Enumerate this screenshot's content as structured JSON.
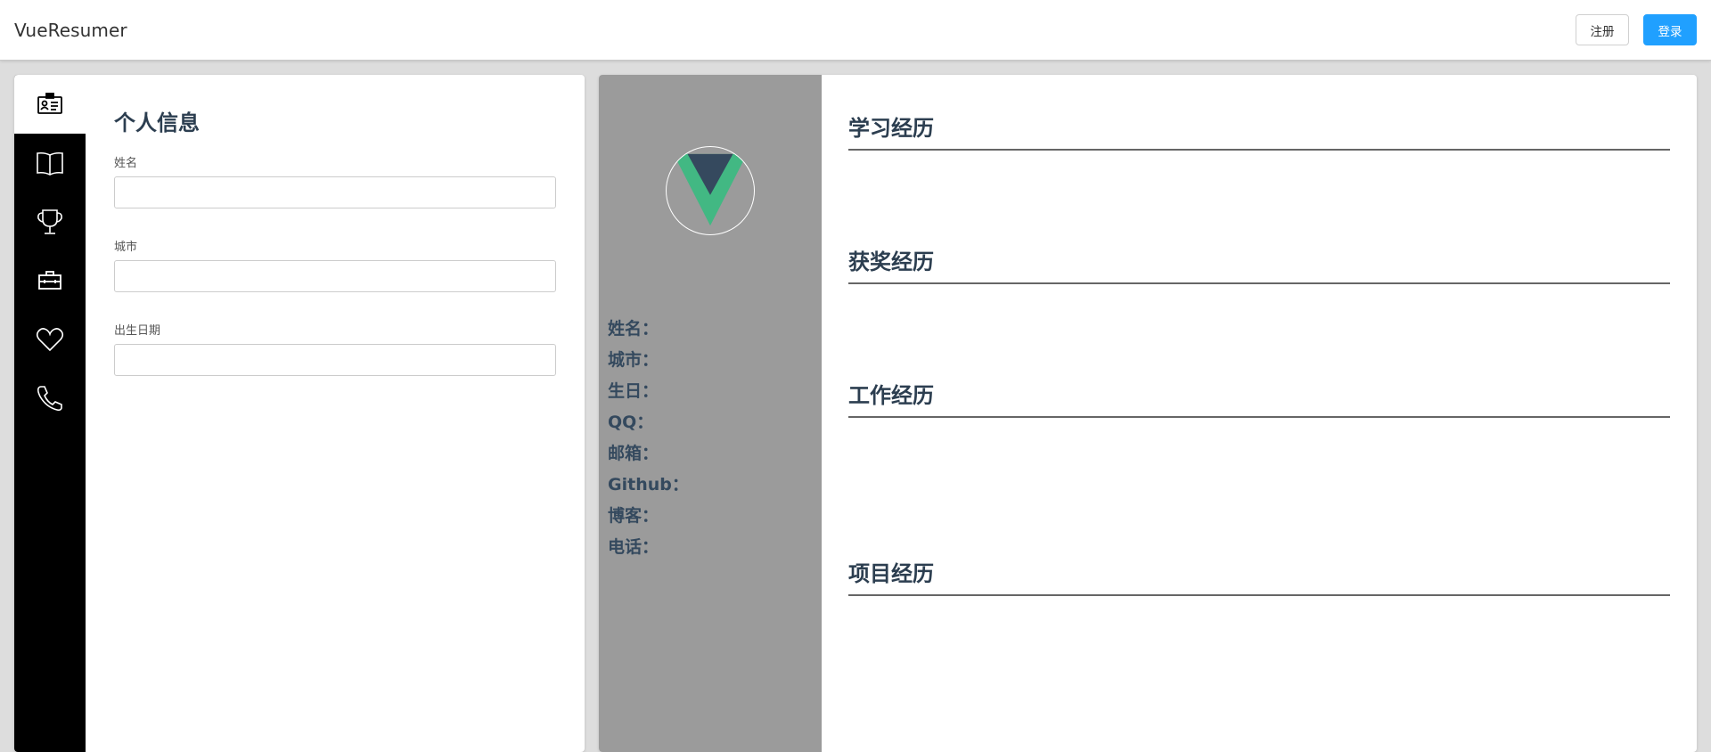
{
  "app": {
    "title": "VueResumer"
  },
  "header": {
    "register_label": "注册",
    "login_label": "登录"
  },
  "sidebar": {
    "items": [
      {
        "name": "profile-card-icon"
      },
      {
        "name": "book-icon"
      },
      {
        "name": "trophy-icon"
      },
      {
        "name": "briefcase-icon"
      },
      {
        "name": "heart-icon"
      },
      {
        "name": "phone-icon"
      }
    ]
  },
  "form": {
    "title": "个人信息",
    "fields": [
      {
        "label": "姓名",
        "value": "",
        "placeholder": ""
      },
      {
        "label": "城市",
        "value": "",
        "placeholder": ""
      },
      {
        "label": "出生日期",
        "value": "",
        "placeholder": ""
      }
    ]
  },
  "preview": {
    "info": [
      "姓名：",
      "城市：",
      "生日：",
      "QQ：",
      "邮箱：",
      "Github：",
      "博客：",
      "电话："
    ],
    "sections": [
      "学习经历",
      "获奖经历",
      "工作经历",
      "项目经历"
    ]
  },
  "colors": {
    "accent": "#20a0ff",
    "sidebar_bg": "#000000",
    "preview_side_bg": "#9b9b9b",
    "vue_green": "#42b883",
    "vue_dark": "#35495e"
  }
}
